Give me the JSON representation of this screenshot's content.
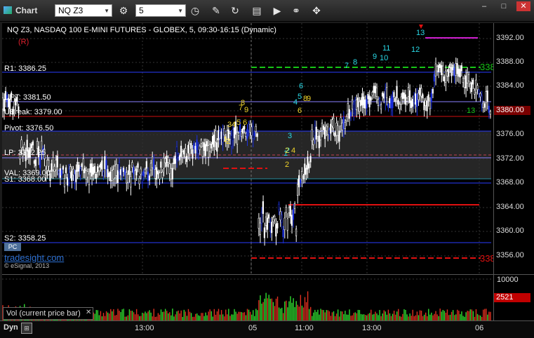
{
  "window": {
    "title": "Chart"
  },
  "toolbar": {
    "symbol": "NQ Z3",
    "interval": "5"
  },
  "chart": {
    "header": "NQ Z3, NASDAQ 100 E-MINI FUTURES - GLOBEX, 5, 09:30-16:15 (Dynamic)",
    "r_marker": "(R)",
    "levels": {
      "r1": "R1: 3386.25",
      "upt": "UPT: 3381.50",
      "ubreak": "UBreak: 3379.00",
      "pivot": "Pivot: 3376.50",
      "lp": "LP: 3372.25",
      "val": "VAL: 3369.00",
      "s1": "S1: 3368.00",
      "s2": "S2: 3358.25"
    },
    "watermark": "tradesight.com",
    "copyright": "© eSignal, 2013",
    "pc_badge": "PC",
    "right_labels": {
      "green": "338",
      "red": "338"
    },
    "seq_labels": {
      "cyan": [
        "13",
        "7",
        "8",
        "9",
        "11",
        "10",
        "12",
        "6",
        "5",
        "4",
        "3",
        "1",
        "2"
      ],
      "yellow": [
        "8",
        "7",
        "9",
        "3",
        "4",
        "5",
        "6",
        "1",
        "2",
        "6",
        "8",
        "9",
        "2",
        "4",
        "2"
      ],
      "green": [
        "13"
      ]
    }
  },
  "price_axis": [
    "3392.00",
    "3388.00",
    "3384.00",
    "3380.00",
    "3376.00",
    "3372.00",
    "3368.00",
    "3364.00",
    "3360.00",
    "3356.00"
  ],
  "last_price": "3380.00",
  "volume": {
    "label": "Vol (current price bar)",
    "axis_top": "10000",
    "last": "2521"
  },
  "time_axis": [
    "13:00",
    "05",
    "11:00",
    "13:00",
    "06"
  ],
  "footer": {
    "dyn": "Dyn"
  },
  "colors": {
    "r1": "#2a3cff",
    "pivot": "#2a3cff",
    "ubreak": "#d01010",
    "upt": "#8a80ff",
    "lp": "#8a80ff",
    "green_line": "#17c417",
    "red_line": "#e01010",
    "magenta_line": "#d020d0"
  }
}
